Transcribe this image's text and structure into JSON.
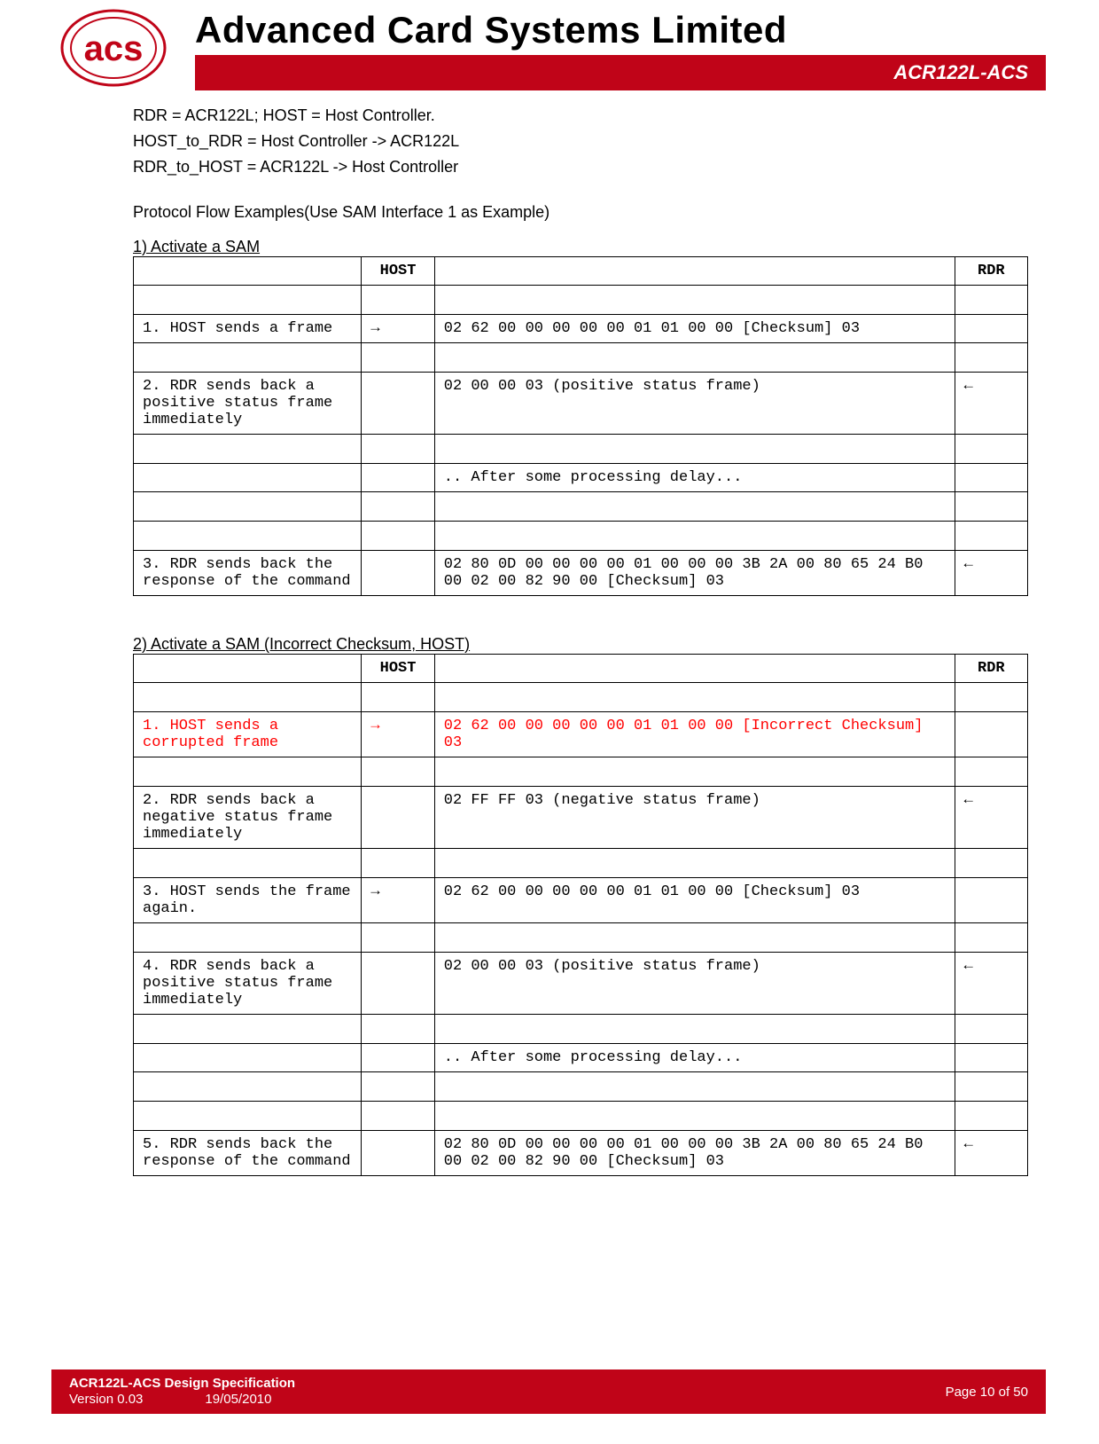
{
  "header": {
    "company": "Advanced Card Systems Limited",
    "product": "ACR122L-ACS",
    "logo_text": "acs"
  },
  "defs": {
    "l1": "RDR = ACR122L; HOST = Host Controller.",
    "l2": "HOST_to_RDR = Host Controller -> ACR122L",
    "l3": "RDR_to_HOST = ACR122L -> Host Controller"
  },
  "section_heading": "Protocol Flow Examples(Use SAM Interface 1 as Example)",
  "ex1": {
    "title": "1) Activate a SAM",
    "cols": {
      "host": "HOST",
      "rdr": "RDR"
    },
    "r1": {
      "desc": "1. HOST sends a frame",
      "arrow": "→",
      "data": "02 62 00 00 00 00 00 01 01 00 00 [Checksum] 03",
      "rdr": ""
    },
    "r2": {
      "desc": "2. RDR sends back a positive status frame immediately",
      "arrow": "",
      "data": "02 00 00 03 (positive status frame)",
      "rdr": "←"
    },
    "r2b": {
      "data": ".. After some processing delay..."
    },
    "r3": {
      "desc": "3. RDR sends back the response of the command",
      "arrow": "",
      "data": "02 80 0D 00 00 00 00 01 00 00 00 3B 2A 00 80 65 24 B0 00 02 00 82 90 00 [Checksum] 03",
      "rdr": "←"
    }
  },
  "ex2": {
    "title": "2) Activate a SAM (Incorrect Checksum, HOST)",
    "cols": {
      "host": "HOST",
      "rdr": "RDR"
    },
    "r1": {
      "desc": "1. HOST sends a corrupted frame",
      "arrow": "→",
      "data": "02 62 00 00 00 00 00 01 01 00 00 [Incorrect Checksum] 03",
      "rdr": ""
    },
    "r2": {
      "desc": "2. RDR sends back a negative status frame immediately",
      "arrow": "",
      "data": "02 FF FF 03 (negative status frame)",
      "rdr": "←"
    },
    "r3": {
      "desc": "3. HOST sends the frame again.",
      "arrow": "→",
      "data": "02 62 00 00 00 00 00 01 01 00 00 [Checksum] 03",
      "rdr": ""
    },
    "r4": {
      "desc": "4. RDR sends back a positive status frame immediately",
      "arrow": "",
      "data": "02 00 00 03 (positive status frame)",
      "rdr": "←"
    },
    "r4b": {
      "data": ".. After some processing delay..."
    },
    "r5": {
      "desc": "5. RDR sends back the response of the command",
      "arrow": "",
      "data": "02 80 0D 00 00 00 00 01 00 00 00 3B 2A 00 80 65 24 B0 00 02 00 82 90 00 [Checksum] 03",
      "rdr": "←"
    }
  },
  "footer": {
    "spec": "ACR122L-ACS Design Specification",
    "version": "Version 0.03",
    "date": "19/05/2010",
    "page": "Page 10 of 50"
  }
}
